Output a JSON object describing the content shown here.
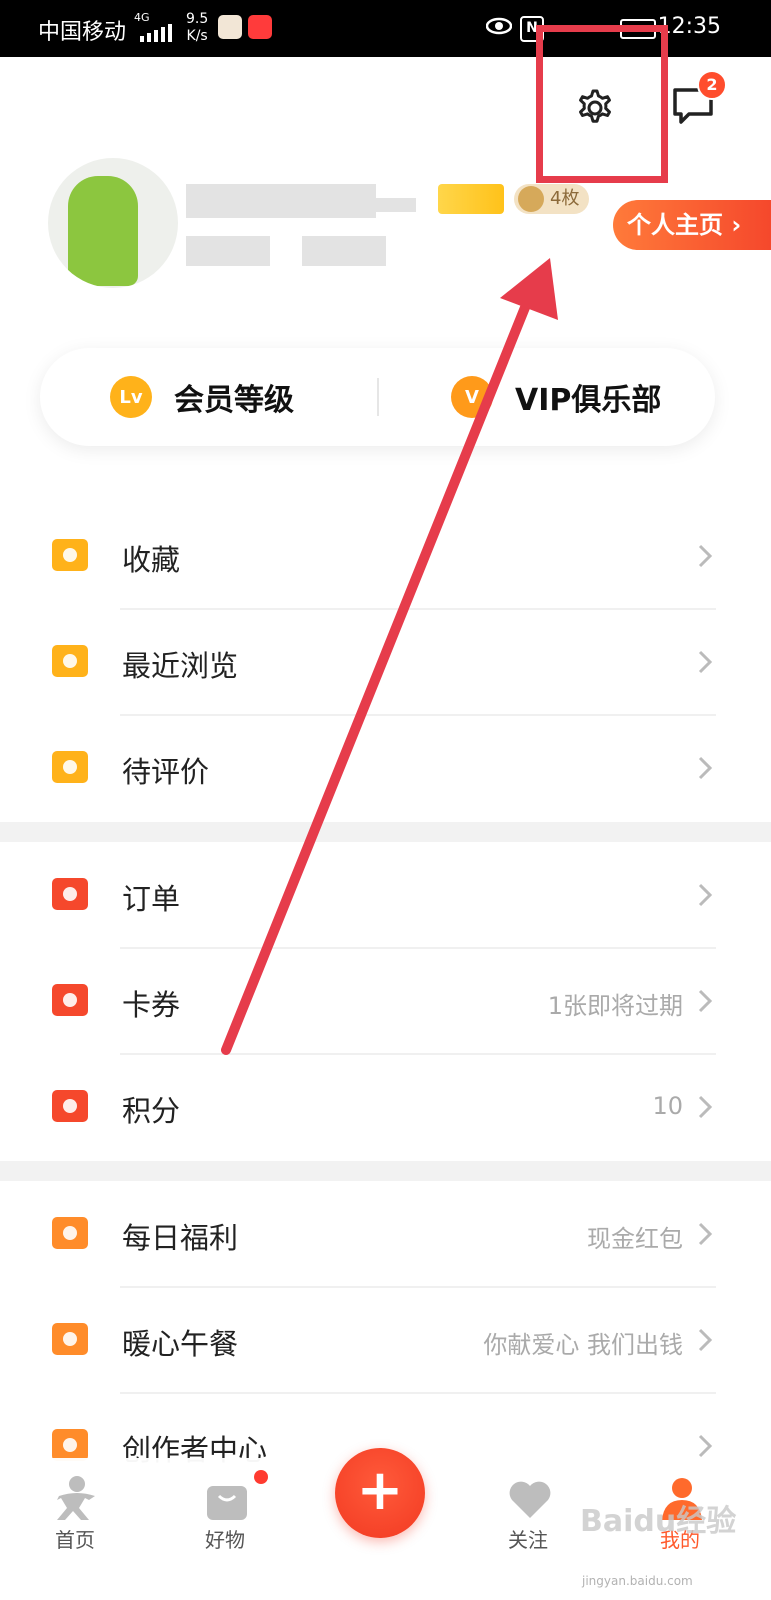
{
  "status_bar": {
    "carrier": "中国移动",
    "network": "4G",
    "speed_value": "9.5",
    "speed_unit": "K/s",
    "time": "12:35"
  },
  "header": {
    "message_badge": "2",
    "medal_count": "4枚",
    "profile_button": "个人主页 ›"
  },
  "member_card": {
    "left_badge": "Lv",
    "left_label": "会员等级",
    "right_badge": "V",
    "right_label": "VIP俱乐部"
  },
  "menu": {
    "items": [
      {
        "label": "收藏",
        "right_text": "",
        "icon": "star-folder-icon"
      },
      {
        "label": "最近浏览",
        "right_text": "",
        "icon": "clock-folder-icon"
      },
      {
        "label": "待评价",
        "right_text": "",
        "icon": "chat-bubble-icon"
      },
      {
        "label": "订单",
        "right_text": "",
        "icon": "clipboard-icon"
      },
      {
        "label": "卡券",
        "right_text": "1张即将过期",
        "icon": "ticket-icon"
      },
      {
        "label": "积分",
        "right_text": "10",
        "icon": "points-icon"
      },
      {
        "label": "每日福利",
        "right_text": "现金红包",
        "icon": "red-envelope-icon"
      },
      {
        "label": "暖心午餐",
        "right_text": "你献爱心 我们出钱",
        "icon": "heart-hand-icon"
      },
      {
        "label": "创作者中心",
        "right_text": "",
        "icon": "lightning-icon"
      }
    ]
  },
  "bottom_nav": {
    "home": "首页",
    "goods": "好物",
    "add": "+",
    "follow": "关注",
    "mine": "我的"
  },
  "watermark": {
    "main": "Baidu经验",
    "sub": "jingyan.baidu.com"
  },
  "colors": {
    "accent": "#f5482c",
    "annotation": "#e63c4b",
    "icon_orange": "#ffb21a"
  }
}
